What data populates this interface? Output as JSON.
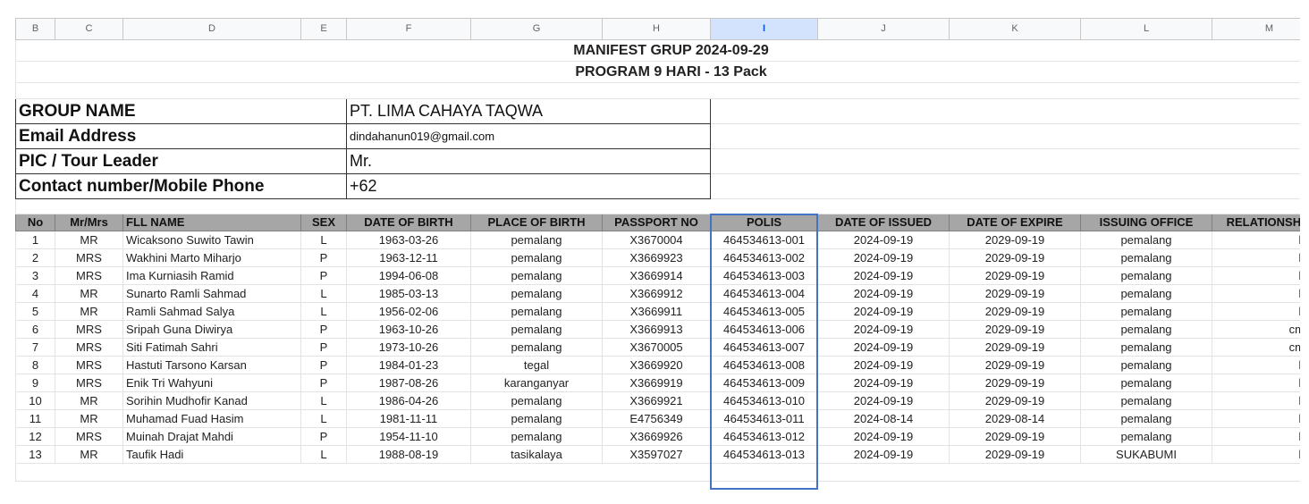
{
  "columns": [
    "B",
    "C",
    "D",
    "E",
    "F",
    "G",
    "H",
    "I",
    "J",
    "K",
    "L",
    "M"
  ],
  "selected_column": "I",
  "title_line1": "MANIFEST GRUP 2024-09-29",
  "title_line2": "PROGRAM 9 HARI - 13 Pack",
  "info": {
    "group_name_label": "GROUP NAME",
    "group_name_value": "PT. LIMA CAHAYA TAQWA",
    "email_label": "Email Address",
    "email_value": "dindahanun019@gmail.com",
    "pic_label": "PIC / Tour Leader",
    "pic_value": "Mr.",
    "contact_label": "Contact number/Mobile Phone",
    "contact_value": "+62"
  },
  "table_headers": [
    "No",
    "Mr/Mrs",
    "FLL NAME",
    "SEX",
    "DATE OF BIRTH",
    "PLACE OF BIRTH",
    "PASSPORT NO",
    "POLIS",
    "DATE OF ISSUED",
    "DATE OF EXPIRE",
    "ISSUING OFFICE",
    "RELATIONSHIP"
  ],
  "rows": [
    [
      "1",
      "MR",
      "Wicaksono Suwito Tawin",
      "L",
      "1963-03-26",
      "pemalang",
      "X3670004",
      "464534613-001",
      "2024-09-19",
      "2029-09-19",
      "pemalang",
      "k"
    ],
    [
      "2",
      "MRS",
      "Wakhini Marto Miharjo",
      "P",
      "1963-12-11",
      "pemalang",
      "X3669923",
      "464534613-002",
      "2024-09-19",
      "2029-09-19",
      "pemalang",
      "k"
    ],
    [
      "3",
      "MRS",
      "Ima Kurniasih Ramid",
      "P",
      "1994-06-08",
      "pemalang",
      "X3669914",
      "464534613-003",
      "2024-09-19",
      "2029-09-19",
      "pemalang",
      "k"
    ],
    [
      "4",
      "MR",
      "Sunarto Ramli Sahmad",
      "L",
      "1985-03-13",
      "pemalang",
      "X3669912",
      "464534613-004",
      "2024-09-19",
      "2029-09-19",
      "pemalang",
      "k"
    ],
    [
      "5",
      "MR",
      "Ramli Sahmad Salya",
      "L",
      "1956-02-06",
      "pemalang",
      "X3669911",
      "464534613-005",
      "2024-09-19",
      "2029-09-19",
      "pemalang",
      "k"
    ],
    [
      "6",
      "MRS",
      "Sripah Guna Diwirya",
      "P",
      "1963-10-26",
      "pemalang",
      "X3669913",
      "464534613-006",
      "2024-09-19",
      "2029-09-19",
      "pemalang",
      "cm"
    ],
    [
      "7",
      "MRS",
      "Siti Fatimah Sahri",
      "P",
      "1973-10-26",
      "pemalang",
      "X3670005",
      "464534613-007",
      "2024-09-19",
      "2029-09-19",
      "pemalang",
      "cm"
    ],
    [
      "8",
      "MRS",
      "Hastuti Tarsono Karsan",
      "P",
      "1984-01-23",
      "tegal",
      "X3669920",
      "464534613-008",
      "2024-09-19",
      "2029-09-19",
      "pemalang",
      "k"
    ],
    [
      "9",
      "MRS",
      "Enik Tri Wahyuni",
      "P",
      "1987-08-26",
      "karanganyar",
      "X3669919",
      "464534613-009",
      "2024-09-19",
      "2029-09-19",
      "pemalang",
      "k"
    ],
    [
      "10",
      "MR",
      "Sorihin Mudhofir Kanad",
      "L",
      "1986-04-26",
      "pemalang",
      "X3669921",
      "464534613-010",
      "2024-09-19",
      "2029-09-19",
      "pemalang",
      "k"
    ],
    [
      "11",
      "MR",
      "Muhamad Fuad Hasim",
      "L",
      "1981-11-11",
      "pemalang",
      "E4756349",
      "464534613-011",
      "2024-08-14",
      "2029-08-14",
      "pemalang",
      "k"
    ],
    [
      "12",
      "MRS",
      "Muinah Drajat Mahdi",
      "P",
      "1954-11-10",
      "pemalang",
      "X3669926",
      "464534613-012",
      "2024-09-19",
      "2029-09-19",
      "pemalang",
      "k"
    ],
    [
      "13",
      "MR",
      "Taufik Hadi",
      "L",
      "1988-08-19",
      "tasikalaya",
      "X3597027",
      "464534613-013",
      "2024-09-19",
      "2029-09-19",
      "SUKABUMI",
      "k"
    ]
  ],
  "accent_color": "#4472c4"
}
